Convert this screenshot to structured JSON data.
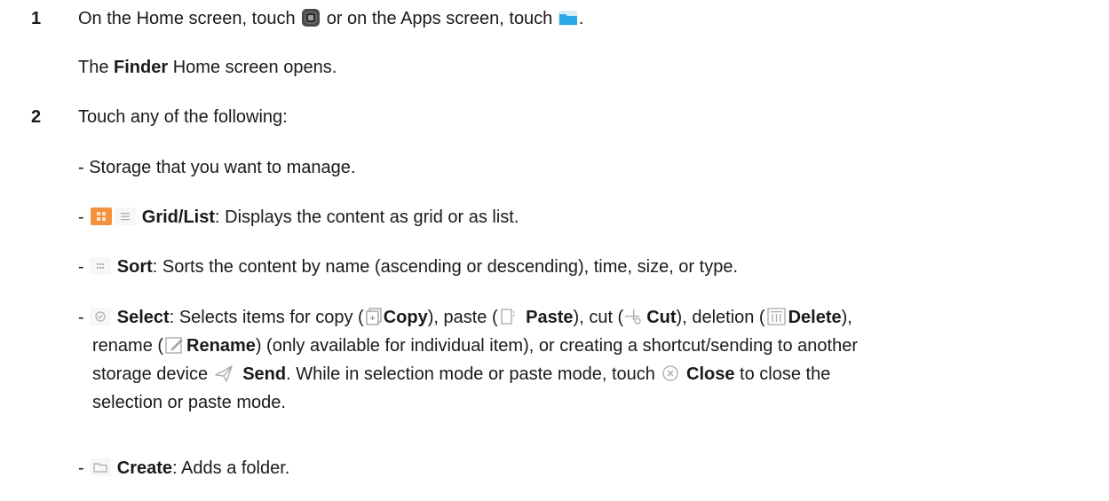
{
  "steps": [
    {
      "number": "1",
      "text_a": "On the Home screen, touch ",
      "text_b": " or on the Apps screen, touch ",
      "text_c": ".",
      "result_a": "The ",
      "result_bold": "Finder",
      "result_b": " Home screen opens."
    },
    {
      "number": "2",
      "intro": "Touch any of the following:",
      "storage_item": "- Storage that you want to manage.",
      "grid_list": {
        "dash": "- ",
        "grid": "Grid",
        "slash": "/",
        "list": "List",
        "desc": ": Displays the content as grid or as list."
      },
      "sort": {
        "dash": "- ",
        "label": "Sort",
        "desc": ": Sorts the content by name (ascending or descending), time, size, or type."
      },
      "select": {
        "dash": "- ",
        "label": "Select",
        "t1": ": Selects items for copy (",
        "copy": "Copy",
        "t2": "), paste (",
        "paste": "Paste",
        "t3": "), cut (",
        "cut": "Cut",
        "t4": "), deletion (",
        "delete": "Delete",
        "t5": "),",
        "t6": "rename (",
        "rename": "Rename",
        "t7": ") (only available for individual item), or creating a shortcut/sending to another",
        "t8": "storage device ",
        "send": "Send",
        "t9": ". While in selection mode or paste mode, touch ",
        "close": "Close",
        "t10": " to close the",
        "t11": "selection or paste mode."
      },
      "create": {
        "dash": "- ",
        "label": "Create",
        "desc": ": Adds a folder."
      }
    }
  ],
  "icons": {
    "finder_home": "finder-app-icon",
    "finder_apps": "folder-app-icon",
    "grid": "grid-view-icon",
    "list": "list-view-icon",
    "sort": "sort-icon",
    "select": "select-icon",
    "copy": "copy-icon",
    "paste": "paste-icon",
    "cut": "cut-icon",
    "delete": "delete-icon",
    "rename": "rename-icon",
    "send": "send-icon",
    "close": "close-icon",
    "create": "create-folder-icon"
  },
  "colors": {
    "text": "#1a1a1a",
    "grid_icon": "#f5913c",
    "folder_icon": "#29a8e8",
    "muted_icon": "#a8a8a8"
  }
}
